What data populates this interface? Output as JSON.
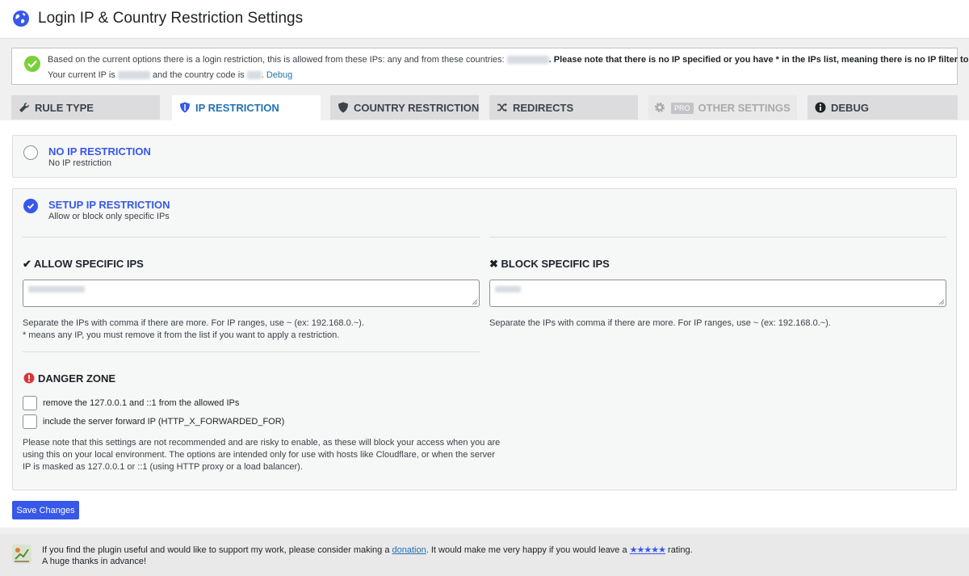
{
  "header": {
    "title": "Login IP & Country Restriction Settings"
  },
  "notice": {
    "line1_prefix": "Based on the current options there is a login restriction, this is allowed from these IPs: any and from these countries:",
    "line1_bold": ". Please note that there is no IP specified or you have * in the IPs list, meaning there is no IP filter to apply.",
    "line2_prefix": "Your current IP is",
    "line2_mid": "and the country code is",
    "debug_link": "Debug"
  },
  "tabs": [
    {
      "label": "Rule Type",
      "icon": "wrench-icon"
    },
    {
      "label": "IP Restriction",
      "icon": "shield-icon"
    },
    {
      "label": "Country Restriction",
      "icon": "shield-icon"
    },
    {
      "label": "Redirects",
      "icon": "shuffle-icon"
    },
    {
      "label": "Other Settings",
      "icon": "gear-icon",
      "badge": "PRO"
    },
    {
      "label": "Debug",
      "icon": "info-icon"
    }
  ],
  "options": {
    "no_ip": {
      "title": "No IP Restriction",
      "subtitle": "No IP restriction"
    },
    "setup_ip": {
      "title": "Setup IP Restriction",
      "subtitle": "Allow or block only specific IPs"
    }
  },
  "allow": {
    "title": "✔ Allow Specific IPs",
    "help1": "Separate the IPs with comma if there are more. For IP ranges, use ~ (ex: 192.168.0.~).",
    "help2": "* means any IP, you must remove it from the list if you want to apply a restriction."
  },
  "block": {
    "title": "✖ Block Specific IPs",
    "help1": "Separate the IPs with comma if there are more. For IP ranges, use ~ (ex: 192.168.0.~)."
  },
  "danger": {
    "title": "Danger Zone",
    "cb1": "remove the 127.0.0.1 and ::1 from the allowed IPs",
    "cb2": "include the server forward IP (HTTP_X_FORWARDED_FOR)",
    "note1": "Please note that this settings are not recommended and are risky to enable, as these will block your access when you are",
    "note2": "using this on your local environment. The options are intended only for use with hosts like Cloudflare, or when the server",
    "note3": "IP is masked as 127.0.0.1 or ::1 (using HTTP proxy or a load balancer)."
  },
  "save_label": "Save Changes",
  "footer": {
    "t1_prefix": "If you find the plugin useful and would like to support my work, please consider making a",
    "donation": "donation",
    "t1_mid": ". It would make me very happy if you would leave a",
    "stars": "★★★★★",
    "t1_suffix": "rating.",
    "t2": "A huge thanks in advance!"
  },
  "colors": {
    "accent": "#3858e9",
    "success": "#7ad03a",
    "danger": "#d63638"
  }
}
